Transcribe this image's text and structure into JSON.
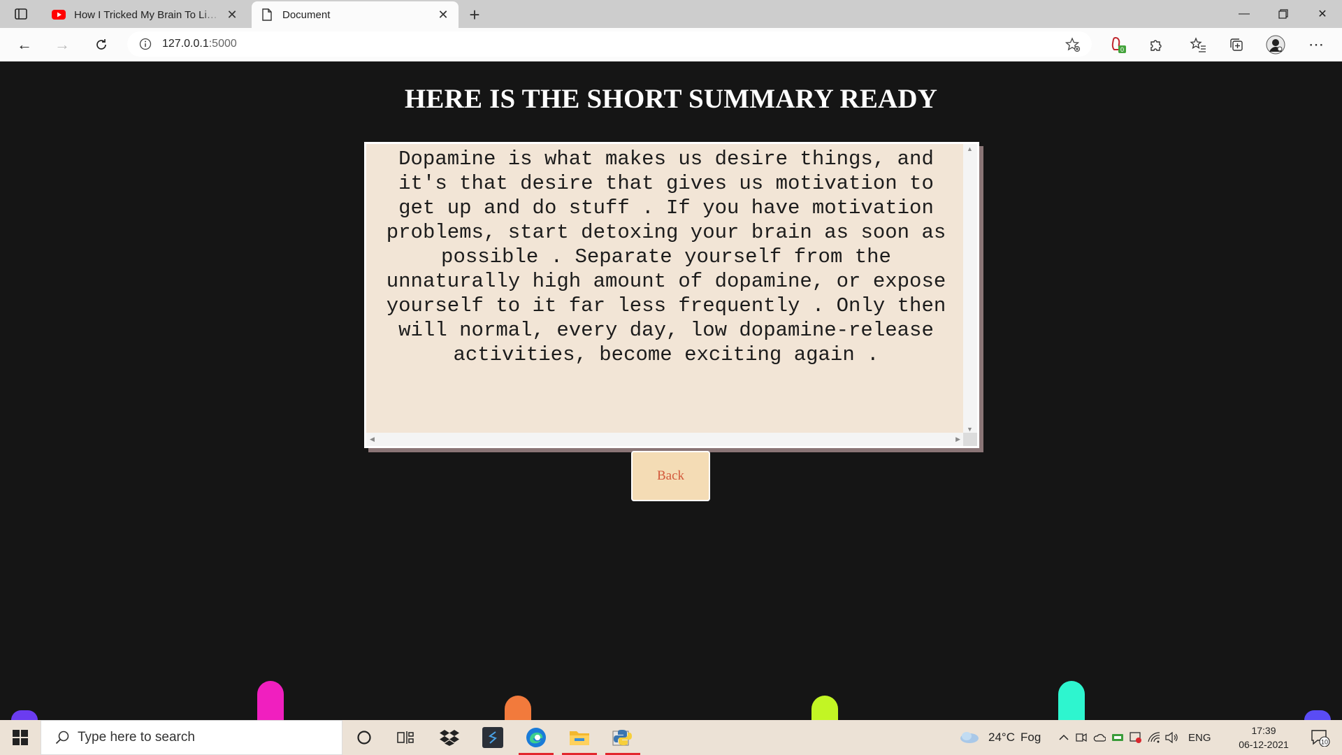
{
  "browser": {
    "tabs": [
      {
        "title": "How I Tricked My Brain To Like Doing Hard Things",
        "active": false
      },
      {
        "title": "Document",
        "active": true
      }
    ],
    "url_host": "127.0.0.1",
    "url_port": ":5000"
  },
  "page": {
    "heading": "HERE IS THE SHORT SUMMARY READY",
    "summary": "Dopamine is what makes us desire things, and it's that desire that gives us motivation to get up and do stuff . If you have motivation problems, start detoxing your brain as soon as possible . Separate yourself from the unnaturally high amount of dopamine, or expose yourself to it far less frequently . Only then will normal, every day, low dopamine-release activities, become exciting again .",
    "back_button": "Back"
  },
  "decor_colors": [
    "#6b3cf0",
    "#f01fbf",
    "#f27a3c",
    "#c2f524",
    "#2ef5cf",
    "#5a4cf5"
  ],
  "taskbar": {
    "search_placeholder": "Type here to search",
    "weather_temp": "24°C",
    "weather_desc": "Fog",
    "language": "ENG",
    "time": "17:39",
    "date": "06-12-2021",
    "notification_count": "10"
  }
}
